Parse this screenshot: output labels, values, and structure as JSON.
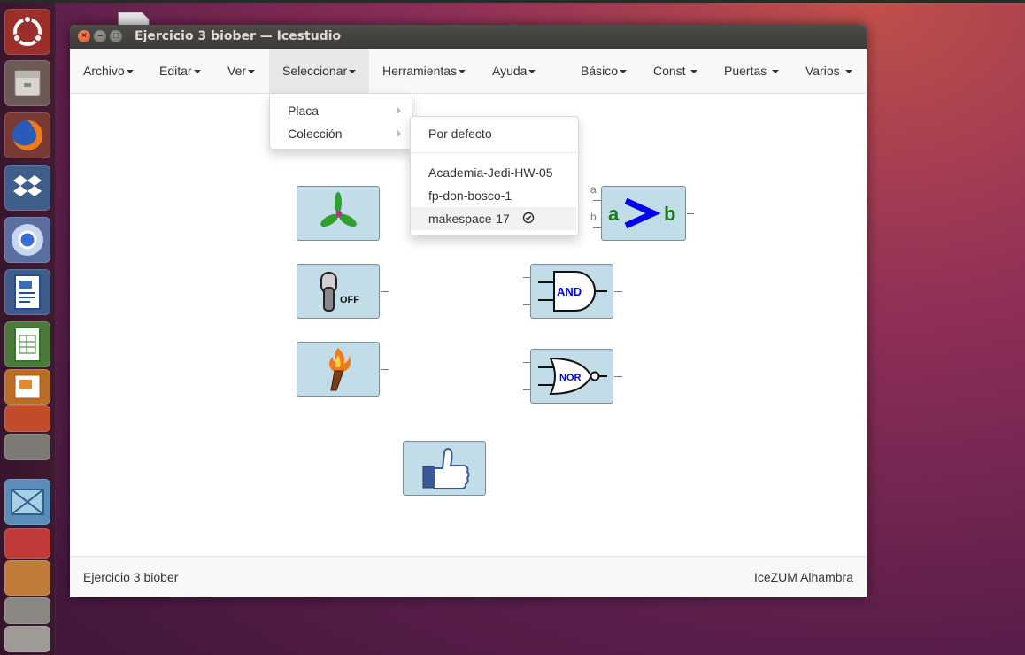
{
  "window": {
    "title": "Ejercicio 3 biober — Icestudio",
    "controls": {
      "close": "×",
      "minimize": "–",
      "maximize": "□"
    }
  },
  "menubar": {
    "items": [
      {
        "label": "Archivo",
        "has_caret": true
      },
      {
        "label": "Editar",
        "has_caret": true
      },
      {
        "label": "Ver",
        "has_caret": true
      },
      {
        "label": "Seleccionar",
        "has_caret": true,
        "active": true
      },
      {
        "label": "Herramientas",
        "has_caret": true
      },
      {
        "label": "Ayuda",
        "has_caret": true
      },
      {
        "label": "Básico",
        "has_caret": true
      },
      {
        "label": "Const",
        "has_caret": true
      },
      {
        "label": "Puertas",
        "has_caret": true
      },
      {
        "label": "Varios",
        "has_caret": true
      }
    ]
  },
  "seleccionar_menu": {
    "items": [
      {
        "label": "Placa",
        "submenu": true
      },
      {
        "label": "Colección",
        "submenu": true
      }
    ]
  },
  "coleccion_submenu": {
    "default_label": "Por defecto",
    "collections": [
      {
        "label": "Academia-Jedi-HW-05",
        "checked": false
      },
      {
        "label": "fp-don-bosco-1",
        "checked": false
      },
      {
        "label": "makespace-17",
        "checked": true
      }
    ]
  },
  "canvas": {
    "blocks": [
      {
        "name": "fan-block",
        "icon": "fan-icon"
      },
      {
        "name": "switch-block",
        "icon": "toggle-switch-off-icon",
        "text": "OFF"
      },
      {
        "name": "torch-block",
        "icon": "torch-icon"
      },
      {
        "name": "thumbs-up-block",
        "icon": "thumbs-up-icon"
      },
      {
        "name": "comparator-block",
        "icon": "comparator-icon",
        "left_operand": "a",
        "symbol": ">",
        "right_operand": "b",
        "port_labels": [
          "a",
          "b"
        ]
      },
      {
        "name": "and-gate-block",
        "icon": "and-gate-icon",
        "text": "AND"
      },
      {
        "name": "nor-gate-block",
        "icon": "nor-gate-icon",
        "text": "NOR"
      }
    ]
  },
  "statusbar": {
    "project_name": "Ejercicio 3 biober",
    "board": "IceZUM Alhambra"
  },
  "colors": {
    "block_fill": "#c3dde8",
    "titlebar": "#3e3d39",
    "menubar": "#f8f8f8",
    "close_button": "#e95420",
    "gate_text": "#0000ff",
    "comparator_letters": "#1a7a1a"
  },
  "launcher": {
    "icons": [
      "ubuntu-logo-icon",
      "files-icon",
      "firefox-icon",
      "dropbox-icon",
      "chromium-icon",
      "writer-icon",
      "calc-icon",
      "impress-icon",
      "stacked-apps-icon",
      "icestudio-icon",
      "stacked-apps-icon-2",
      "stacked-apps-icon-3"
    ]
  }
}
